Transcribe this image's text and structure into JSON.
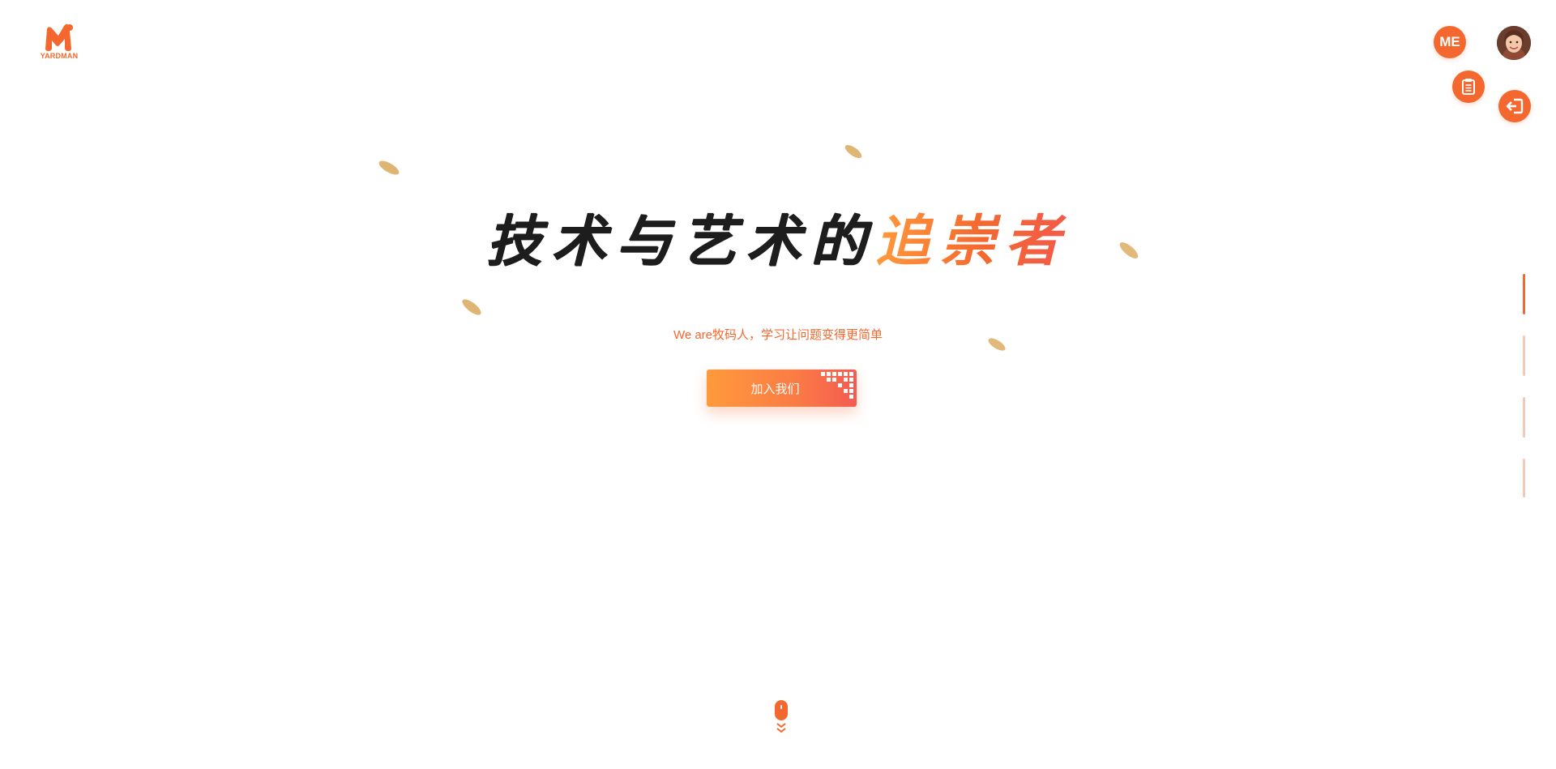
{
  "logo": {
    "text": "YARDMAN",
    "icon": "m-logo-icon",
    "color": "#f4682f"
  },
  "header": {
    "me_label": "ME",
    "doc_icon": "document-icon",
    "exit_icon": "exit-icon",
    "avatar_icon": "user-avatar"
  },
  "hero": {
    "headline_dark": "技术与艺术的",
    "headline_accent": "追崇者",
    "subtitle": "We are牧码人，学习让问题变得更简单",
    "join_label": "加入我们"
  },
  "side_nav": {
    "active_index": 0,
    "count": 4
  },
  "scroll_hint_icon": "mouse-scroll-icon",
  "colors": {
    "accent": "#f4682f",
    "accent_light": "#ff9a3c",
    "dark": "#1d1d1d",
    "leaf": "#d9a85a"
  }
}
